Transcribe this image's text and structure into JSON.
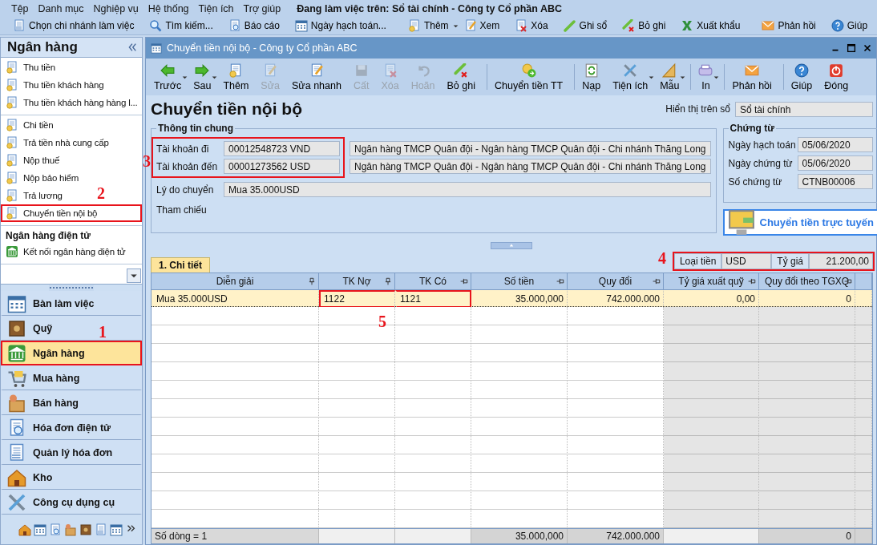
{
  "menu": [
    "Tệp",
    "Danh mục",
    "Nghiệp vụ",
    "Hệ thống",
    "Tiện ích",
    "Trợ giúp"
  ],
  "working_on": "Đang làm việc trên: Sổ tài chính - Công ty Cổ phần ABC",
  "toolbar": [
    {
      "label": "Chọn chi nhánh làm việc",
      "dropdown": false
    },
    {
      "label": "Tìm kiếm...",
      "dropdown": false
    },
    {
      "label": "Báo cáo",
      "dropdown": false
    },
    {
      "label": "Ngày hạch toán...",
      "dropdown": false
    },
    {
      "label": "Thêm",
      "dropdown": true
    },
    {
      "label": "Xem",
      "dropdown": false
    },
    {
      "label": "Xóa",
      "dropdown": false
    },
    {
      "label": "Ghi sổ",
      "dropdown": false
    },
    {
      "label": "Bỏ ghi",
      "dropdown": false
    },
    {
      "label": "Xuất khẩu",
      "dropdown": false
    },
    {
      "label": "Phản hồi",
      "dropdown": false
    },
    {
      "label": "Giúp",
      "dropdown": false
    }
  ],
  "sidebar": {
    "title": "Ngân hàng",
    "groups": [
      {
        "items": [
          {
            "label": "Thu tiền",
            "marked": false
          },
          {
            "label": "Thu tiền khách hàng",
            "marked": false
          },
          {
            "label": "Thu tiền khách hàng hàng l...",
            "marked": false
          }
        ]
      },
      {
        "items": [
          {
            "label": "Chi tiền",
            "marked": false
          },
          {
            "label": "Trả tiền nhà cung cấp",
            "marked": false
          },
          {
            "label": "Nộp thuế",
            "marked": false
          },
          {
            "label": "Nộp bảo hiểm",
            "marked": false
          },
          {
            "label": "Trả lương",
            "marked": false
          },
          {
            "label": "Chuyển tiền nội bộ",
            "marked": true,
            "marker": "2"
          }
        ]
      },
      {
        "heading": "Ngân hàng điện tử",
        "items": [
          {
            "label": "Kết nối ngân hàng điện tử",
            "marked": false
          }
        ]
      }
    ]
  },
  "modules": [
    {
      "label": "Bàn làm việc",
      "selected": false,
      "marked": false
    },
    {
      "label": "Quỹ",
      "selected": false,
      "marked": false
    },
    {
      "label": "Ngân hàng",
      "selected": true,
      "marked": true,
      "marker": "1"
    },
    {
      "label": "Mua hàng",
      "selected": false,
      "marked": false
    },
    {
      "label": "Bán hàng",
      "selected": false,
      "marked": false
    },
    {
      "label": "Hóa đơn điện tử",
      "selected": false,
      "marked": false
    },
    {
      "label": "Quản lý hóa đơn",
      "selected": false,
      "marked": false
    },
    {
      "label": "Kho",
      "selected": false,
      "marked": false
    },
    {
      "label": "Công cụ dụng cụ",
      "selected": false,
      "marked": false
    }
  ],
  "document_window": {
    "title": "Chuyển tiền nội bộ - Công ty Cổ phần ABC",
    "toolbar": [
      {
        "label": "Trước",
        "disabled": false,
        "dropdown": true
      },
      {
        "label": "Sau",
        "disabled": false,
        "dropdown": true
      },
      {
        "label": "Thêm",
        "disabled": false,
        "dropdown": false
      },
      {
        "label": "Sửa",
        "disabled": true,
        "dropdown": false
      },
      {
        "label": "Sửa nhanh",
        "disabled": false,
        "dropdown": false
      },
      {
        "label": "Cất",
        "disabled": true,
        "dropdown": false
      },
      {
        "label": "Xóa",
        "disabled": true,
        "dropdown": false
      },
      {
        "label": "Hoãn",
        "disabled": true,
        "dropdown": false
      },
      {
        "label": "Bỏ ghi",
        "disabled": false,
        "dropdown": false
      },
      {
        "label": "Chuyển tiền TT",
        "disabled": false,
        "dropdown": false
      },
      {
        "label": "Nạp",
        "disabled": false,
        "dropdown": false
      },
      {
        "label": "Tiện ích",
        "disabled": false,
        "dropdown": true
      },
      {
        "label": "Mẫu",
        "disabled": false,
        "dropdown": true
      },
      {
        "label": "In",
        "disabled": false,
        "dropdown": true
      },
      {
        "label": "Phản hồi",
        "disabled": false,
        "dropdown": false
      },
      {
        "label": "Giúp",
        "disabled": false,
        "dropdown": false
      },
      {
        "label": "Đóng",
        "disabled": false,
        "dropdown": false
      }
    ],
    "heading": "Chuyển tiền nội bộ",
    "book": {
      "label": "Hiển thị trên sổ",
      "value": "Sổ tài chính"
    },
    "general": {
      "legend": "Thông tin chung",
      "accounts_marked": true,
      "accounts_marker": "3",
      "accounts": [
        {
          "label": "Tài khoản đi",
          "account": "00012548723 VND",
          "bank": "Ngân hàng TMCP Quân đội  - Ngân hàng TMCP Quân đội - Chi nhánh Thăng Long"
        },
        {
          "label": "Tài khoản đến",
          "account": "00001273562 USD",
          "bank": "Ngân hàng TMCP Quân đội  - Ngân hàng TMCP Quân đội - Chi nhánh Thăng Long"
        }
      ],
      "reason": {
        "label": "Lý do chuyển",
        "value": "Mua 35.000USD"
      },
      "reference": {
        "label": "Tham chiếu"
      }
    },
    "voucher": {
      "legend": "Chứng từ",
      "fields": [
        {
          "label": "Ngày hạch toán",
          "value": "05/06/2020"
        },
        {
          "label": "Ngày chứng từ",
          "value": "05/06/2020"
        },
        {
          "label": "Số chứng từ",
          "value": "CTNB00006"
        }
      ]
    },
    "online_button": "Chuyển tiền trực tuyến",
    "tab": {
      "label": "1. Chi tiết",
      "selected": true
    },
    "currency": {
      "label": "Loại tiền",
      "value": "USD",
      "rate_label": "Tỷ giá",
      "rate": "21.200,00",
      "marked": true,
      "marker": "4"
    },
    "table": {
      "columns": [
        {
          "label": "Diễn giải",
          "readonly": false
        },
        {
          "label": "TK Nợ",
          "readonly": false
        },
        {
          "label": "TK Có",
          "readonly": false
        },
        {
          "label": "Số tiền",
          "readonly": false
        },
        {
          "label": "Quy đổi",
          "readonly": false
        },
        {
          "label": "Tỷ giá xuất quỹ",
          "readonly": true
        },
        {
          "label": "Quy đổi theo TGXQ",
          "readonly": true
        }
      ],
      "rows": [
        {
          "selected": true,
          "marker": "5",
          "cells": [
            {
              "text": "Mua 35.000USD",
              "marked": false
            },
            {
              "text": "1122",
              "marked": true
            },
            {
              "text": "1121",
              "marked": true
            },
            {
              "text": "35.000,000",
              "marked": false
            },
            {
              "text": "742.000.000",
              "marked": false
            },
            {
              "text": "0,00",
              "marked": false
            },
            {
              "text": "0",
              "marked": false
            }
          ]
        }
      ],
      "footer": {
        "row_count": "Số dòng = 1",
        "amount": "35.000,000",
        "converted": "742.000.000",
        "converted_tgxq": "0"
      }
    }
  }
}
